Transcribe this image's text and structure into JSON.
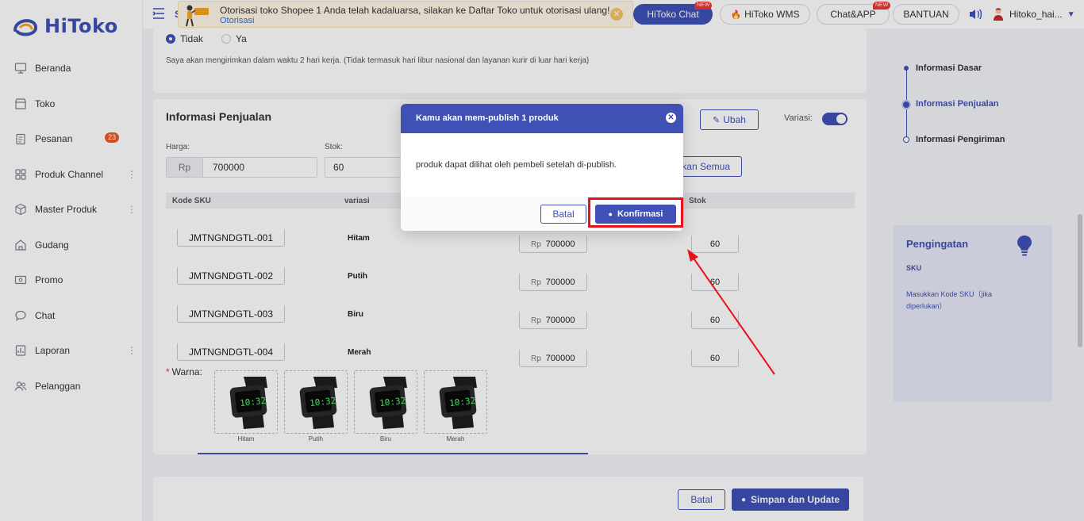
{
  "brand": {
    "name": "HiToko",
    "color": "#3f51b5"
  },
  "sidebar": {
    "items": [
      {
        "label": "Beranda",
        "icon": "monitor-icon"
      },
      {
        "label": "Toko",
        "icon": "store-icon"
      },
      {
        "label": "Pesanan",
        "icon": "clipboard-icon",
        "badge": "23"
      },
      {
        "label": "Produk Channel",
        "icon": "grid-icon",
        "more": true
      },
      {
        "label": "Master Produk",
        "icon": "cube-icon",
        "more": true
      },
      {
        "label": "Gudang",
        "icon": "warehouse-icon"
      },
      {
        "label": "Promo",
        "icon": "ticket-icon"
      },
      {
        "label": "Chat",
        "icon": "chat-icon"
      },
      {
        "label": "Laporan",
        "icon": "report-icon",
        "more": true
      },
      {
        "label": "Pelanggan",
        "icon": "users-icon"
      }
    ]
  },
  "topbar": {
    "partial_title": "S",
    "notice_text": "Otorisasi toko Shopee 1 Anda telah kadaluarsa, silakan ke Daftar Toko untuk otorisasi ulang!",
    "notice_link": "Otorisasi",
    "hitoko_chat": "HiToko Chat",
    "hitoko_wms": "HiToko WMS",
    "chat_app": "Chat&APP",
    "bantuan": "BANTUAN",
    "new_tag": "NEW",
    "username": "Hitoko_hai..."
  },
  "shipping": {
    "option_no": "Tidak",
    "option_yes": "Ya",
    "note": "Saya akan mengirimkan dalam waktu 2 hari kerja. (Tidak termasuk hari libur nasional dan layanan kurir di luar hari kerja)"
  },
  "sales": {
    "title": "Informasi Penjualan",
    "edit_button": "Ubah",
    "variation_label": "Variasi:",
    "price_label": "Harga:",
    "price_prefix": "Rp",
    "price_value": "700000",
    "stock_label": "Stok:",
    "stock_value": "60",
    "apply_all_partial": "kan Semua",
    "columns": {
      "sku": "Kode SKU",
      "variant": "variasi",
      "stock": "Stok"
    },
    "rows": [
      {
        "sku": "JMTNGNDGTL-001",
        "variant": "Hitam",
        "price": "700000",
        "stock": "60"
      },
      {
        "sku": "JMTNGNDGTL-002",
        "variant": "Putih",
        "price": "700000",
        "stock": "60"
      },
      {
        "sku": "JMTNGNDGTL-003",
        "variant": "Biru",
        "price": "700000",
        "stock": "60"
      },
      {
        "sku": "JMTNGNDGTL-004",
        "variant": "Merah",
        "price": "700000",
        "stock": "60"
      }
    ],
    "color_label": "Warna:",
    "color_required_mark": "*",
    "colors": [
      "Hitam",
      "Putih",
      "Biru",
      "Merah"
    ]
  },
  "steps": {
    "items": [
      "Informasi Dasar",
      "Informasi Penjualan",
      "Informasi Pengiriman"
    ]
  },
  "reminder": {
    "title": "Pengingatan",
    "sku": "SKU",
    "desc": "Masukkan Kode SKU（jika diperlukan）"
  },
  "footer": {
    "cancel": "Batal",
    "save": "Simpan dan Update"
  },
  "modal": {
    "title": "Kamu akan mem-publish 1 produk",
    "body": "produk dapat dilihat oleh pembeli setelah di-publish.",
    "cancel": "Batal",
    "confirm": "Konfirmasi"
  }
}
